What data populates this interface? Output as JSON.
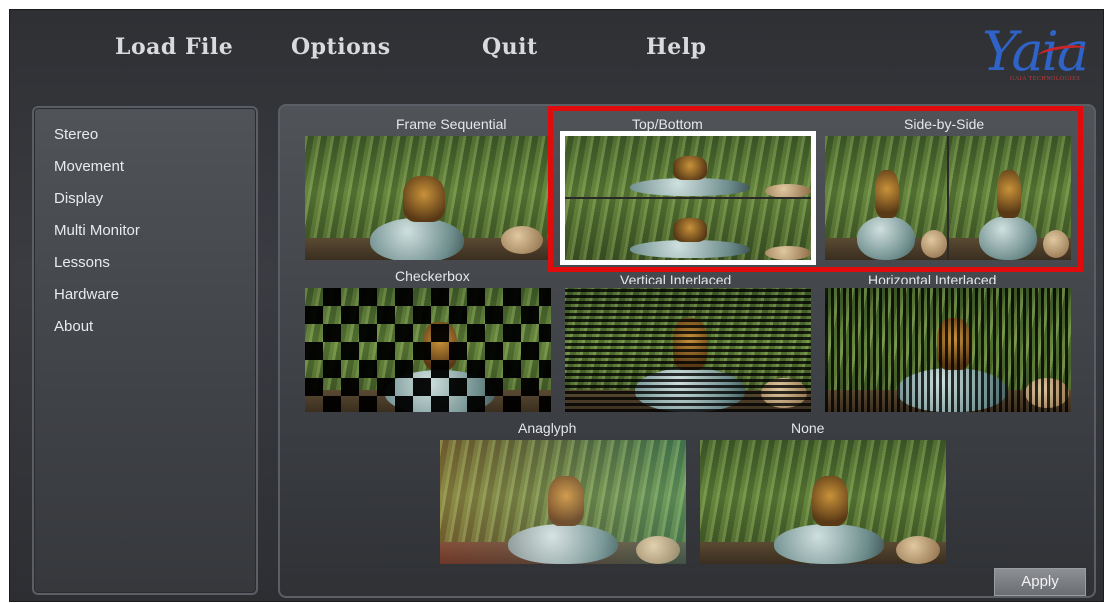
{
  "menu": {
    "load_file": "Load File",
    "options": "Options",
    "quit": "Quit",
    "help": "Help"
  },
  "logo": {
    "text": "Yaia",
    "subtitle": "GAIA TECHNOLOGIES"
  },
  "sidebar": {
    "items": [
      {
        "label": "Stereo"
      },
      {
        "label": "Movement"
      },
      {
        "label": "Display"
      },
      {
        "label": "Multi Monitor"
      },
      {
        "label": "Lessons"
      },
      {
        "label": "Hardware"
      },
      {
        "label": "About"
      }
    ]
  },
  "modes": [
    {
      "label": "Frame Sequential",
      "selected": false
    },
    {
      "label": "Top/Bottom",
      "selected": true
    },
    {
      "label": "Side-by-Side",
      "selected": false
    },
    {
      "label": "Checkerbox",
      "selected": false
    },
    {
      "label": "Vertical Interlaced",
      "selected": false
    },
    {
      "label": "Horizontal Interlaced",
      "selected": false
    },
    {
      "label": "Anaglyph",
      "selected": false
    },
    {
      "label": "None",
      "selected": false
    }
  ],
  "apply_button": "Apply",
  "colors": {
    "highlight": "#e10b0b",
    "selection": "#ffffff",
    "logo_blue": "#2f63c7"
  }
}
